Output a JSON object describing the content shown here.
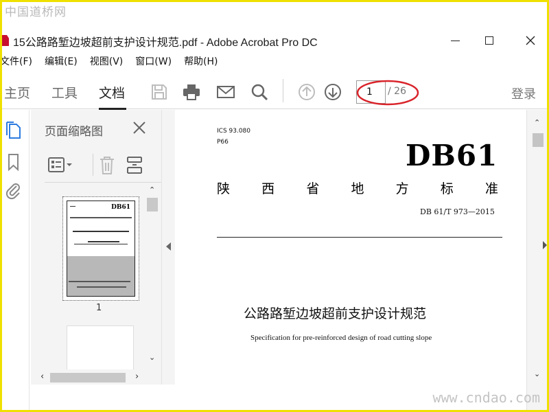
{
  "watermark": {
    "top": "中国道桥网",
    "bottom": "www.cndao.com"
  },
  "window": {
    "title": "15公路路堑边坡超前支护设计规范.pdf - Adobe Acrobat Pro DC"
  },
  "menu": [
    "文件(F)",
    "编辑(E)",
    "视图(V)",
    "窗口(W)",
    "帮助(H)"
  ],
  "toolbar": {
    "tabs": [
      "主页",
      "工具",
      "文档"
    ],
    "active_tab": "文档",
    "page_current": "1",
    "page_total": "/ 26",
    "login": "登录",
    "icons": [
      "save-icon",
      "print-icon",
      "email-icon",
      "search-icon",
      "page-up-icon",
      "page-down-icon"
    ],
    "highlight_color": "#d9232a"
  },
  "panel": {
    "title": "页面缩略图",
    "thumbnail_label": "1",
    "thumbnail_heading": "DB61"
  },
  "document": {
    "ics": "ICS 93.080",
    "class": "P66",
    "db": "DB61",
    "province": [
      "陕",
      "西",
      "省",
      "地",
      "方",
      "标",
      "准"
    ],
    "code": "DB 61/T 973—2015",
    "title_cn": "公路路堑边坡超前支护设计规范",
    "title_en": "Specification for pre-reinforced design of road cutting slope"
  }
}
